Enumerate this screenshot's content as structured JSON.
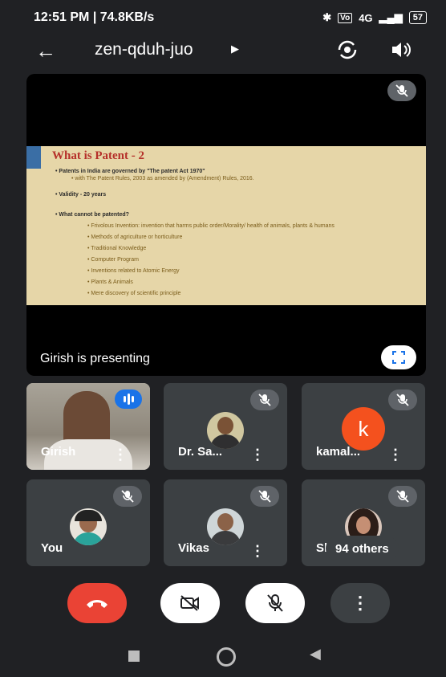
{
  "status_bar": {
    "time_speed": "12:51 PM | 74.8KB/s",
    "signal": "4G",
    "battery": "57"
  },
  "header": {
    "meeting_code": "zen-qduh-juo"
  },
  "stage": {
    "presenting_text": "Girish is presenting",
    "slide": {
      "title": "What is Patent - 2",
      "lines": [
        "• Patents in India are governed by \"The patent Act 1970\"",
        "• with The Patent Rules, 2003 as amended by (Amendment) Rules, 2016.",
        "• Validity - 20 years",
        "• What cannot be patented?",
        "• Frivolous Invention: invention that harms public order/Morality/ health of animals, plants & humans",
        "• Methods of agriculture or horticulture",
        "• Traditional Knowledge",
        "• Computer Program",
        "• Inventions related to Atomic Energy",
        "• Plants & Animals",
        "• Mere discovery of scientific principle"
      ]
    }
  },
  "participants": [
    {
      "name": "Girish",
      "state": "speaking"
    },
    {
      "name": "Dr. Sa...",
      "state": "muted"
    },
    {
      "name": "kamal...",
      "state": "muted",
      "initial": "k"
    },
    {
      "name": "You",
      "state": "muted"
    },
    {
      "name": "Vikas",
      "state": "muted"
    },
    {
      "name": "Sh",
      "state": "muted"
    }
  ],
  "others_label": "94 others",
  "colors": {
    "end_call": "#ea4335",
    "avatar_k": "#f4511e",
    "speaking": "#1a73e8"
  }
}
